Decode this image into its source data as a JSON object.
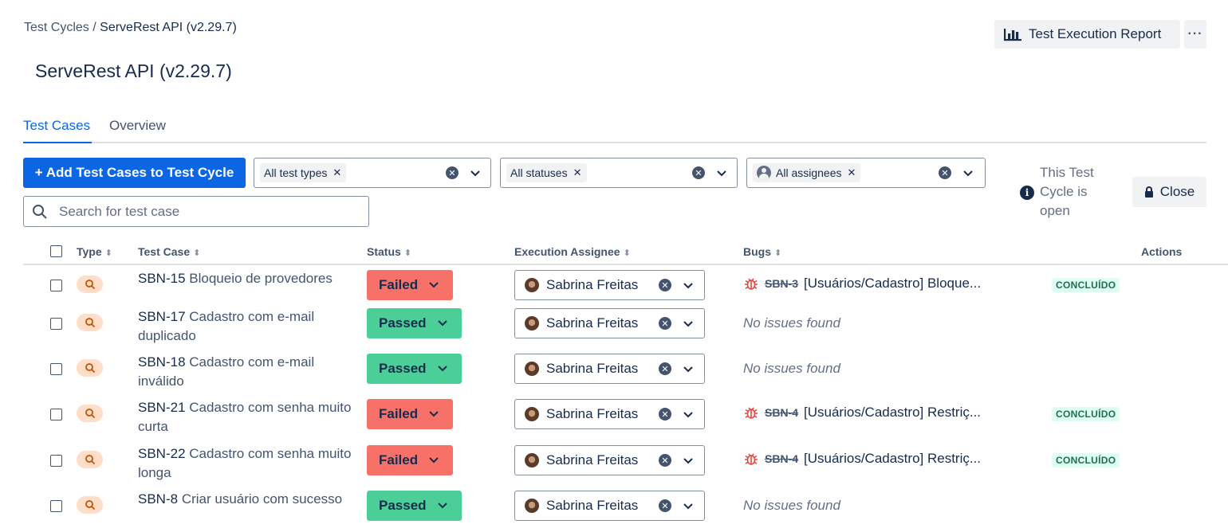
{
  "breadcrumb": {
    "parent": "Test Cycles",
    "separator": " / ",
    "current": "ServeRest API (v2.29.7)"
  },
  "page_title": "ServeRest API (v2.29.7)",
  "header_actions": {
    "report_label": "Test Execution Report",
    "more_label": "···"
  },
  "tabs": [
    {
      "label": "Test Cases",
      "active": true
    },
    {
      "label": "Overview",
      "active": false
    }
  ],
  "toolbar": {
    "add_label": "+ Add Test Cases to Test Cycle",
    "filters": {
      "types": "All test types",
      "statuses": "All statuses",
      "assignees": "All assignees"
    },
    "search_placeholder": "Search for test case",
    "cycle_info": "This Test Cycle is open",
    "close_label": "Close"
  },
  "table": {
    "columns": {
      "type": "Type",
      "test_case": "Test Case",
      "status": "Status",
      "assignee": "Execution Assignee",
      "bugs": "Bugs",
      "actions": "Actions"
    },
    "rows": [
      {
        "key": "SBN-15",
        "title": "Bloqueio de provedores",
        "status": "Failed",
        "assignee": "Sabrina Freitas",
        "bug_key": "SBN-3",
        "bug_summary": "[Usuários/Cadastro] Bloque...",
        "bug_status": "CONCLUÍDO",
        "no_issues": ""
      },
      {
        "key": "SBN-17",
        "title": "Cadastro com e-mail duplicado",
        "status": "Passed",
        "assignee": "Sabrina Freitas",
        "bug_key": "",
        "bug_summary": "",
        "bug_status": "",
        "no_issues": "No issues found"
      },
      {
        "key": "SBN-18",
        "title": "Cadastro com e-mail inválido",
        "status": "Passed",
        "assignee": "Sabrina Freitas",
        "bug_key": "",
        "bug_summary": "",
        "bug_status": "",
        "no_issues": "No issues found"
      },
      {
        "key": "SBN-21",
        "title": "Cadastro com senha muito curta",
        "status": "Failed",
        "assignee": "Sabrina Freitas",
        "bug_key": "SBN-4",
        "bug_summary": "[Usuários/Cadastro] Restriç...",
        "bug_status": "CONCLUÍDO",
        "no_issues": ""
      },
      {
        "key": "SBN-22",
        "title": "Cadastro com senha muito longa",
        "status": "Failed",
        "assignee": "Sabrina Freitas",
        "bug_key": "SBN-4",
        "bug_summary": "[Usuários/Cadastro] Restriç...",
        "bug_status": "CONCLUÍDO",
        "no_issues": ""
      },
      {
        "key": "SBN-8",
        "title": "Criar usuário com sucesso",
        "status": "Passed",
        "assignee": "Sabrina Freitas",
        "bug_key": "",
        "bug_summary": "",
        "bug_status": "",
        "no_issues": "No issues found"
      }
    ]
  },
  "colors": {
    "accent": "#0c66e4",
    "failed": "#f87168",
    "passed": "#4bce97",
    "type_badge": "#fedec8",
    "type_icon": "#c25100",
    "bug_icon": "#e2483d",
    "done_lozenge_bg": "#dcfff1",
    "done_lozenge_text": "#216e4e"
  },
  "icons": {
    "report": "bar-chart-icon",
    "type": "search-magnifier-icon",
    "bug": "bug-icon",
    "info": "info-icon",
    "close": "lock-icon"
  }
}
